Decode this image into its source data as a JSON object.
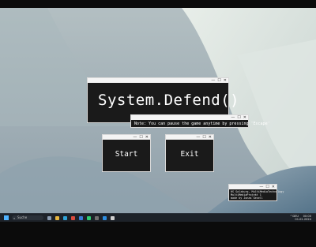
{
  "game": {
    "title": "System.Defend()",
    "note": "Note: You can pause the game anytime by pressing 'Escape'",
    "buttons": {
      "start": "Start",
      "exit": "Exit"
    },
    "credits": [
      "HS Salzburg, MultiMediaTechnology",
      "MultiMediaProjekt 1",
      "made by Jonas Gesell"
    ]
  },
  "window_controls": {
    "minimize": "—",
    "maximize": "☐",
    "close": "✕"
  },
  "taskbar": {
    "search_placeholder": "Suche",
    "tray": {
      "language": "DEU",
      "clock_time": "00:00",
      "clock_date": "01.01.2024"
    },
    "apps": [
      {
        "name": "task-view",
        "color": "#8a9bb0"
      },
      {
        "name": "files",
        "color": "#e7b640"
      },
      {
        "name": "edge",
        "color": "#2fa3d8"
      },
      {
        "name": "chrome",
        "color": "#d94b3e"
      },
      {
        "name": "mail",
        "color": "#3a7bd5"
      },
      {
        "name": "spotify",
        "color": "#2ecc71"
      },
      {
        "name": "terminal",
        "color": "#6f6f6f"
      },
      {
        "name": "vscode",
        "color": "#2c8de0"
      },
      {
        "name": "game",
        "color": "#cfcfcf"
      }
    ]
  }
}
